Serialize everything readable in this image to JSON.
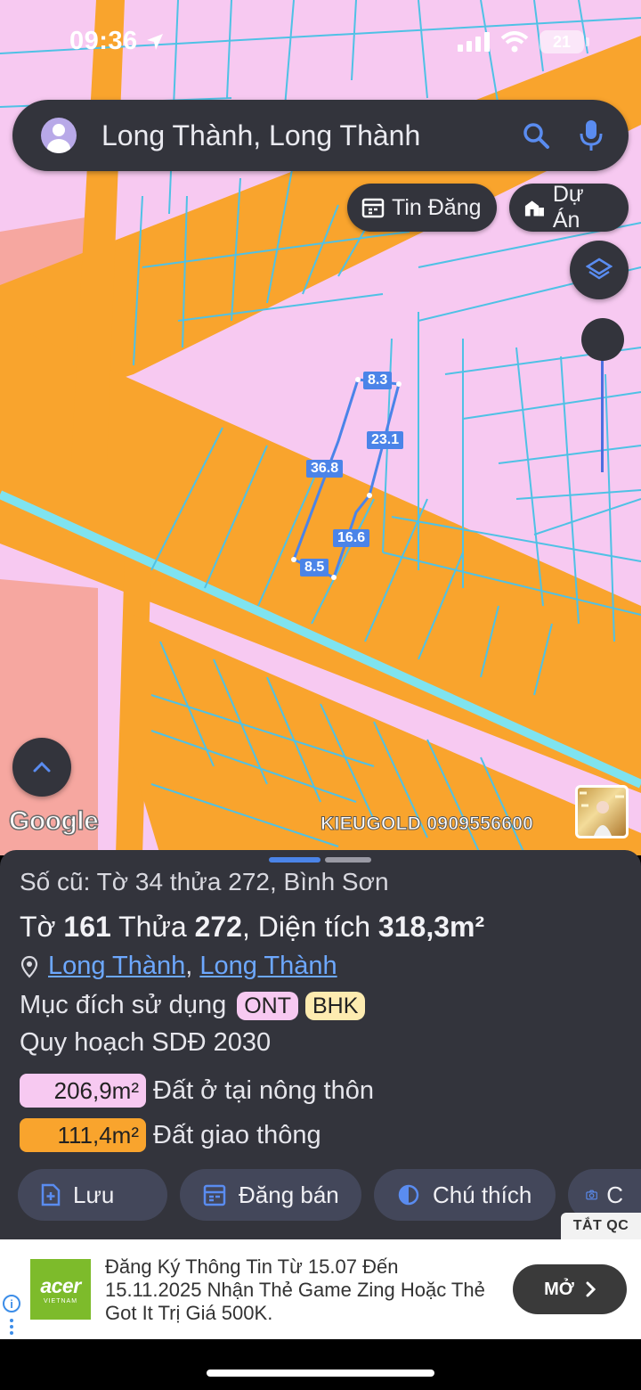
{
  "status_bar": {
    "time": "09:36",
    "battery": "21"
  },
  "search": {
    "text": "Long Thành, Long Thành"
  },
  "chips": {
    "listings": "Tin Đăng",
    "projects": "Dự Án"
  },
  "map": {
    "dimensions": [
      "8.3",
      "23.1",
      "36.8",
      "16.6",
      "8.5"
    ],
    "google_logo": "Google",
    "watermark": "KIEUGOLD 0909556600",
    "colors": {
      "residential": "#f7c9f1",
      "road": "#f9a42d",
      "parcel_line": "#4fc1e5",
      "selection": "#4b84e8"
    }
  },
  "sheet": {
    "old_id": "Số cũ: Tờ 34 thửa 272, Bình Sơn",
    "title_prefix": "Tờ ",
    "sheet_no": "161",
    "title_mid1": " Thửa ",
    "parcel_no": "272",
    "title_mid2": ", Diện tích ",
    "area": "318,3m²",
    "location_1": "Long Thành",
    "location_sep": ",",
    "location_2": "Long Thành",
    "purpose_label": "Mục đích sử dụng",
    "purpose_tags": [
      "ONT",
      "BHK"
    ],
    "plan_label": "Quy hoạch SDĐ 2030",
    "uses": [
      {
        "area": "206,9m²",
        "label": "Đất ở tại nông thôn",
        "color": "#f7c9f1"
      },
      {
        "area": "111,4m²",
        "label": "Đất giao thông",
        "color": "#f9a42d"
      }
    ],
    "actions": {
      "save": "Lưu",
      "sell": "Đăng bán",
      "legend": "Chú thích",
      "photo": "C"
    },
    "ad_off": "TẮT QC"
  },
  "ad": {
    "brand": "acer",
    "brand_sub": "VIETNAM",
    "text": "Đăng Ký Thông Tin Từ 15.07 Đến 15.11.2025 Nhận Thẻ Game Zing Hoặc Thẻ Got It Trị Giá 500K.",
    "cta": "MỞ"
  }
}
